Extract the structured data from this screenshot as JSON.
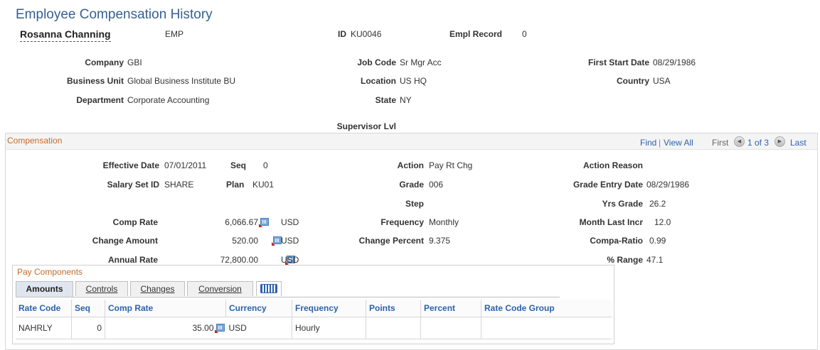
{
  "page": {
    "title": "Employee Compensation History"
  },
  "header": {
    "employee_name": "Rosanna Channing",
    "emp_type": "EMP",
    "id_label": "ID",
    "id_value": "KU0046",
    "empl_record_label": "Empl Record",
    "empl_record_value": "0",
    "company_label": "Company",
    "company_value": "GBI",
    "business_unit_label": "Business Unit",
    "business_unit_value": "Global Business Institute BU",
    "department_label": "Department",
    "department_value": "Corporate Accounting",
    "job_code_label": "Job Code",
    "job_code_value": "Sr Mgr Acc",
    "location_label": "Location",
    "location_value": "US HQ",
    "state_label": "State",
    "state_value": "NY",
    "first_start_date_label": "First Start Date",
    "first_start_date_value": "08/29/1986",
    "country_label": "Country",
    "country_value": "USA",
    "supervisor_lvl_label": "Supervisor Lvl"
  },
  "compensation": {
    "section_title": "Compensation",
    "find_link": "Find",
    "separator": "|",
    "view_all_link": "View All",
    "first_label": "First",
    "page_indicator": "1 of 3",
    "last_label": "Last",
    "effective_date_label": "Effective Date",
    "effective_date_value": "07/01/2011",
    "seq_label": "Seq",
    "seq_value": "0",
    "salary_set_id_label": "Salary Set ID",
    "salary_set_id_value": "SHARE",
    "plan_label": "Plan",
    "plan_value": "KU01",
    "comp_rate_label": "Comp Rate",
    "comp_rate_value": "6,066.67",
    "comp_rate_currency": "USD",
    "change_amount_label": "Change Amount",
    "change_amount_value": "520.00",
    "change_amount_currency": "USD",
    "annual_rate_label": "Annual Rate",
    "annual_rate_value": "72,800.00",
    "annual_rate_currency": "USD",
    "action_label": "Action",
    "action_value": "Pay Rt Chg",
    "grade_label": "Grade",
    "grade_value": "006",
    "step_label": "Step",
    "frequency_label": "Frequency",
    "frequency_value": "Monthly",
    "change_percent_label": "Change Percent",
    "change_percent_value": "9.375",
    "action_reason_label": "Action Reason",
    "grade_entry_date_label": "Grade Entry Date",
    "grade_entry_date_value": "08/29/1986",
    "yrs_grade_label": "Yrs Grade",
    "yrs_grade_value": "26.2",
    "month_last_incr_label": "Month Last Incr",
    "month_last_incr_value": "12.0",
    "compa_ratio_label": "Compa-Ratio",
    "compa_ratio_value": "0.99",
    "range_label": "% Range",
    "range_value": "47.1"
  },
  "pay_components": {
    "title": "Pay Components",
    "tabs": [
      "Amounts",
      "Controls",
      "Changes",
      "Conversion"
    ],
    "columns": [
      "Rate Code",
      "Seq",
      "Comp Rate",
      "Currency",
      "Frequency",
      "Points",
      "Percent",
      "Rate Code Group"
    ],
    "rows": [
      {
        "rate_code": "NAHRLY",
        "seq": "0",
        "comp_rate": "35.00",
        "currency": "USD",
        "frequency": "Hourly",
        "points": "",
        "percent": "",
        "rate_code_group": ""
      }
    ]
  }
}
